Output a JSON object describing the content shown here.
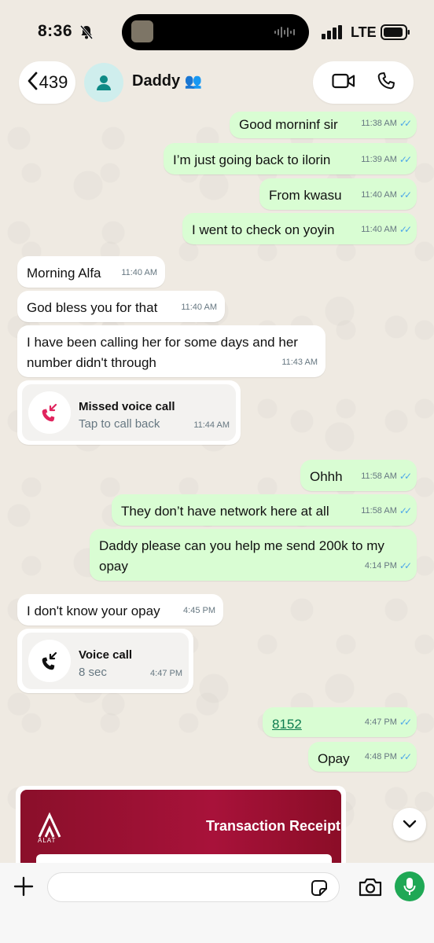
{
  "status_bar": {
    "time": "8:36",
    "network": "LTE"
  },
  "header": {
    "back_count": "439",
    "contact_name": "Daddy",
    "contact_emoji": "👥"
  },
  "messages": [
    {
      "text": "Good morninf sir",
      "time": "11:38 AM"
    },
    {
      "text": "I’m just going back to ilorin",
      "time": "11:39 AM"
    },
    {
      "text": "From kwasu",
      "time": "11:40 AM"
    },
    {
      "text": "I went to check on yoyin",
      "time": "11:40 AM"
    },
    {
      "text": "Morning Alfa",
      "time": "11:40 AM"
    },
    {
      "text": "God bless you for that",
      "time": "11:40 AM"
    },
    {
      "line1": "I have been calling her for some days and her",
      "line2": "number didn't through",
      "time": "11:43 AM"
    },
    {
      "title": "Missed voice call",
      "sub": "Tap to call back",
      "time": "11:44 AM"
    },
    {
      "text": "Ohhh",
      "time": "11:58 AM"
    },
    {
      "text": "They don’t have network here at all",
      "time": "11:58 AM"
    },
    {
      "line1": "Daddy please can you help me send 200k to my",
      "line2": "opay",
      "time": "4:14 PM"
    },
    {
      "text": "I don't know your opay",
      "time": "4:45 PM"
    },
    {
      "title": "Voice call",
      "sub": "8 sec",
      "time": "4:47 PM"
    },
    {
      "text": "8152",
      "time": "4:47 PM"
    },
    {
      "text": "Opay",
      "time": "4:48 PM"
    }
  ],
  "receipt": {
    "brand": "ALAT",
    "title": "Transaction Receipt"
  },
  "colors": {
    "outgoing": "#d9fdd3",
    "incoming": "#ffffff",
    "accent": "#1fa855",
    "missed": "#e0245e"
  }
}
